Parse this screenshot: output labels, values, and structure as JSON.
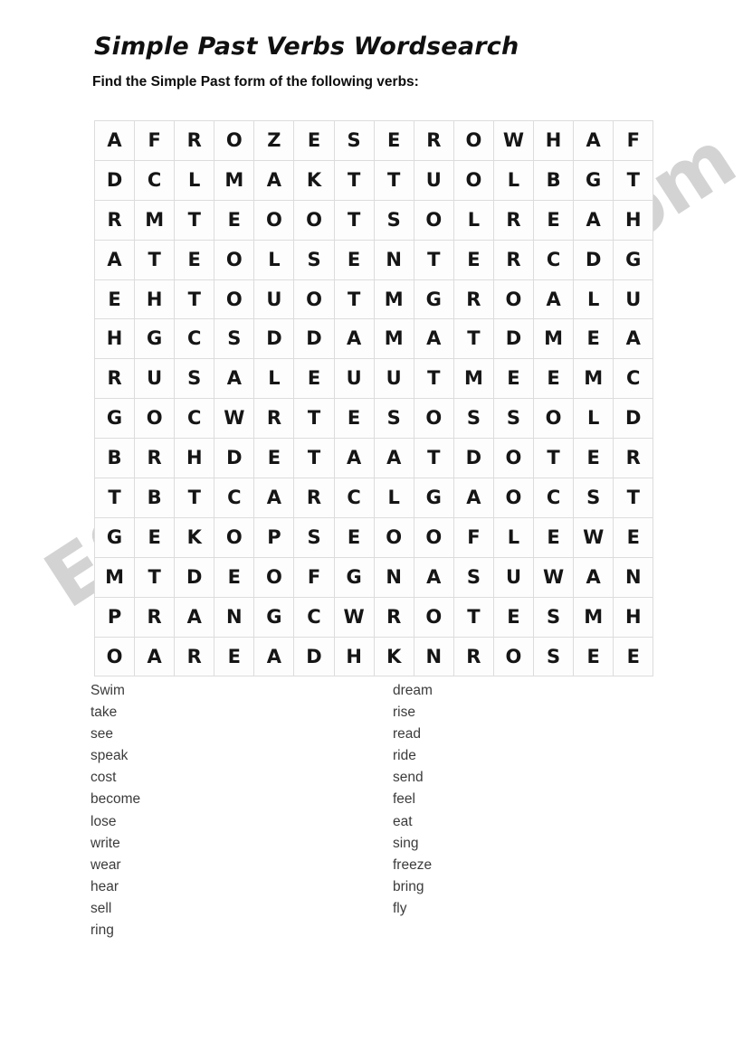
{
  "document": {
    "title": "Simple Past Verbs Wordsearch",
    "instruction": "Find the Simple Past form of the following verbs:"
  },
  "watermark": {
    "text": "ESLprintables.com",
    "color": "#8c8c8c"
  },
  "grid": {
    "rows": 14,
    "columns": 14,
    "border_color": "#dcdcdc",
    "letter_color": "#151515",
    "letters": [
      [
        "A",
        "F",
        "R",
        "O",
        "Z",
        "E",
        "S",
        "E",
        "R",
        "O",
        "W",
        "H",
        "A",
        "F"
      ],
      [
        "D",
        "C",
        "L",
        "M",
        "A",
        "K",
        "T",
        "T",
        "U",
        "O",
        "L",
        "B",
        "G",
        "T"
      ],
      [
        "R",
        "M",
        "T",
        "E",
        "O",
        "O",
        "T",
        "S",
        "O",
        "L",
        "R",
        "E",
        "A",
        "H"
      ],
      [
        "A",
        "T",
        "E",
        "O",
        "L",
        "S",
        "E",
        "N",
        "T",
        "E",
        "R",
        "C",
        "D",
        "G"
      ],
      [
        "E",
        "H",
        "T",
        "O",
        "U",
        "O",
        "T",
        "M",
        "G",
        "R",
        "O",
        "A",
        "L",
        "U"
      ],
      [
        "H",
        "G",
        "C",
        "S",
        "D",
        "D",
        "A",
        "M",
        "A",
        "T",
        "D",
        "M",
        "E",
        "A"
      ],
      [
        "R",
        "U",
        "S",
        "A",
        "L",
        "E",
        "U",
        "U",
        "T",
        "M",
        "E",
        "E",
        "M",
        "C"
      ],
      [
        "G",
        "O",
        "C",
        "W",
        "R",
        "T",
        "E",
        "S",
        "O",
        "S",
        "S",
        "O",
        "L",
        "D"
      ],
      [
        "B",
        "R",
        "H",
        "D",
        "E",
        "T",
        "A",
        "A",
        "T",
        "D",
        "O",
        "T",
        "E",
        "R"
      ],
      [
        "T",
        "B",
        "T",
        "C",
        "A",
        "R",
        "C",
        "L",
        "G",
        "A",
        "O",
        "C",
        "S",
        "T"
      ],
      [
        "G",
        "E",
        "K",
        "O",
        "P",
        "S",
        "E",
        "O",
        "O",
        "F",
        "L",
        "E",
        "W",
        "E"
      ],
      [
        "M",
        "T",
        "D",
        "E",
        "O",
        "F",
        "G",
        "N",
        "A",
        "S",
        "U",
        "W",
        "A",
        "N"
      ],
      [
        "P",
        "R",
        "A",
        "N",
        "G",
        "C",
        "W",
        "R",
        "O",
        "T",
        "E",
        "S",
        "M",
        "H"
      ],
      [
        "O",
        "A",
        "R",
        "E",
        "A",
        "D",
        "H",
        "K",
        "N",
        "R",
        "O",
        "S",
        "E",
        "E"
      ]
    ]
  },
  "word_list": {
    "left_column": [
      "Swim",
      "take",
      "see",
      "speak",
      "cost",
      "become",
      "lose",
      "write",
      "wear",
      "hear",
      "sell",
      "ring"
    ],
    "right_column": [
      "dream",
      "rise",
      "read",
      "ride",
      "send",
      "feel",
      "eat",
      "sing",
      "freeze",
      "bring",
      "fly"
    ]
  }
}
